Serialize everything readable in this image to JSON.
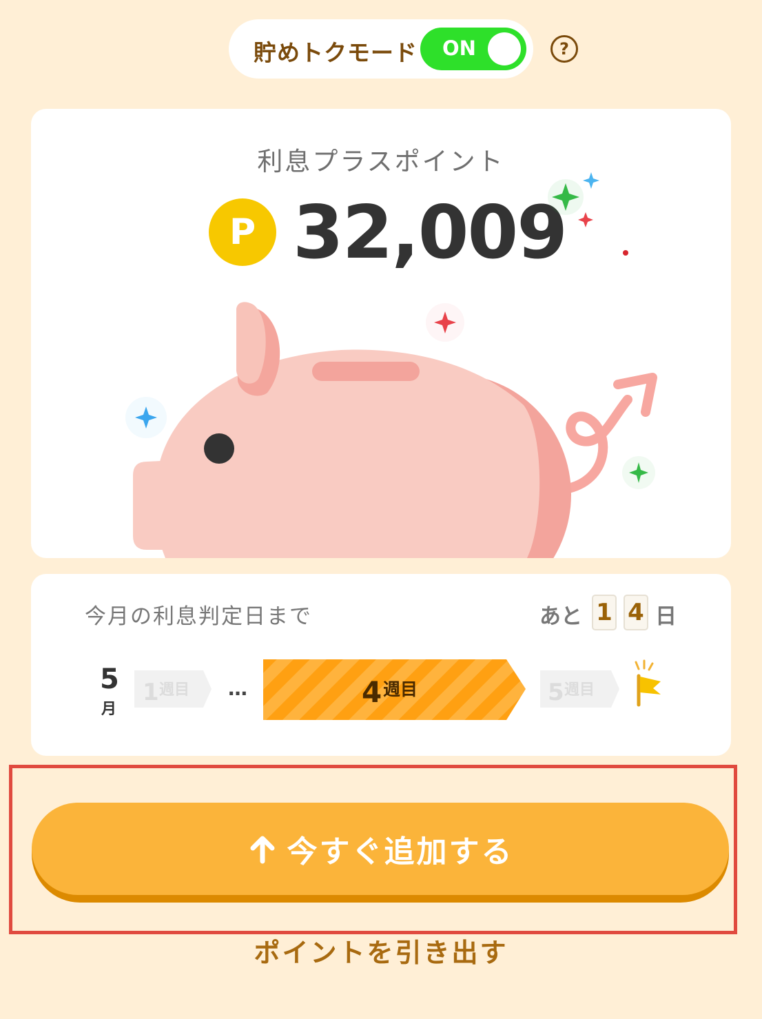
{
  "mode": {
    "label": "貯めトクモード",
    "toggle_text": "ON",
    "help_symbol": "?",
    "icon": "question-circle-icon"
  },
  "points_card": {
    "title": "利息プラスポイント",
    "coin_symbol": "P",
    "value": "32,009",
    "illustration": "piggy-bank-icon"
  },
  "countdown": {
    "label": "今月の利息判定日まで",
    "remain_prefix": "あと",
    "digits": [
      "1",
      "4"
    ],
    "remain_suffix": "日",
    "month_number": "5",
    "month_unit": "月",
    "weeks": [
      {
        "num": "1",
        "unit": "週目",
        "state": "past"
      },
      {
        "num": "4",
        "unit": "週目",
        "state": "current"
      },
      {
        "num": "5",
        "unit": "週目",
        "state": "future"
      }
    ],
    "ellipsis": "…",
    "goal_icon": "goal-flag-icon"
  },
  "actions": {
    "add_label": "今すぐ追加する",
    "add_icon": "arrow-up-icon",
    "withdraw_label": "ポイントを引き出す"
  },
  "colors": {
    "background": "#FFEFD6",
    "toggle_on": "#2EE02A",
    "coin": "#F7C800",
    "primary_button": "#FBB43A",
    "current_week": "#FFA012",
    "highlight_frame": "#E04A3F"
  }
}
